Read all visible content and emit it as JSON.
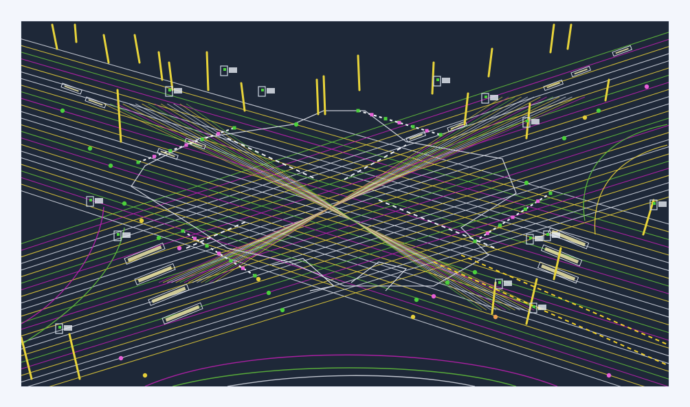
{
  "scene": {
    "kind": "hd-map-intersection-render",
    "colors": {
      "page_bg": "#f3f6fc",
      "map_bg": "#1e2838",
      "lane_white": "#d9dde6",
      "lane_yellow": "#e6cf3a",
      "lane_green": "#63c23b",
      "lane_magenta": "#c21fb4",
      "pole_yellow": "#e8d43a",
      "dashed_white": "#eef0f4",
      "dashed_yellow": "#f2d02a",
      "marker_green": "#4cd13c",
      "marker_pink": "#e860d8"
    },
    "icons": [
      "traffic-sign-icon",
      "lane-arrow-icon",
      "pole-icon",
      "stop-line-icon",
      "crosswalk-icon"
    ]
  }
}
